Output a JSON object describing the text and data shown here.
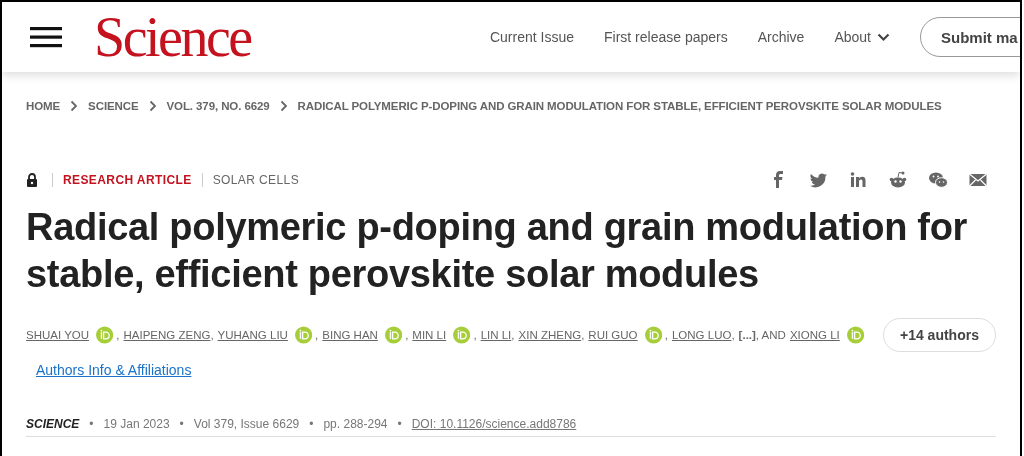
{
  "header": {
    "logo": "Science",
    "nav": [
      {
        "label": "Current Issue",
        "dropdown": false
      },
      {
        "label": "First release papers",
        "dropdown": false
      },
      {
        "label": "Archive",
        "dropdown": false
      },
      {
        "label": "About",
        "dropdown": true
      }
    ],
    "submit_button": "Submit ma"
  },
  "breadcrumb": [
    "HOME",
    "SCIENCE",
    "VOL. 379, NO. 6629",
    "RADICAL POLYMERIC P-DOPING AND GRAIN MODULATION FOR STABLE, EFFICIENT PEROVSKITE SOLAR MODULES"
  ],
  "article_type": "RESEARCH ARTICLE",
  "subject": "SOLAR CELLS",
  "title": "Radical polymeric p-doping and grain modulation for stable, efficient perovskite solar modules",
  "authors": [
    {
      "kind": "author",
      "text": "SHUAI YOU",
      "orcid": true
    },
    {
      "kind": "plain",
      "text": ","
    },
    {
      "kind": "author",
      "text": "HAIPENG ZENG",
      "orcid": false
    },
    {
      "kind": "plain",
      "text": ","
    },
    {
      "kind": "author",
      "text": "YUHANG LIU",
      "orcid": true
    },
    {
      "kind": "plain",
      "text": ","
    },
    {
      "kind": "author",
      "text": "BING HAN",
      "orcid": true
    },
    {
      "kind": "plain",
      "text": ","
    },
    {
      "kind": "author",
      "text": "MIN LI",
      "orcid": true
    },
    {
      "kind": "plain",
      "text": ","
    },
    {
      "kind": "author",
      "text": "LIN LI",
      "orcid": false
    },
    {
      "kind": "plain",
      "text": ","
    },
    {
      "kind": "author",
      "text": "XIN ZHENG",
      "orcid": false
    },
    {
      "kind": "plain",
      "text": ","
    },
    {
      "kind": "author",
      "text": "RUI GUO",
      "orcid": true
    },
    {
      "kind": "plain",
      "text": ","
    },
    {
      "kind": "author",
      "text": "LONG LUO",
      "orcid": false
    },
    {
      "kind": "plain",
      "text": ","
    },
    {
      "kind": "bold",
      "text": "[...]"
    },
    {
      "kind": "plain",
      "text": ", AND"
    },
    {
      "kind": "author",
      "text": "XIONG LI",
      "orcid": true
    }
  ],
  "more_authors": "+14 authors",
  "affiliations_link": "Authors Info & Affiliations",
  "meta": {
    "separator": "•",
    "items": [
      {
        "kind": "journal",
        "text": "SCIENCE"
      },
      {
        "kind": "plain",
        "text": "19 Jan 2023"
      },
      {
        "kind": "plain",
        "text": "Vol 379, Issue 6629"
      },
      {
        "kind": "plain",
        "text": "pp. 288-294"
      },
      {
        "kind": "link",
        "text": "DOI: 10.1126/science.add8786"
      }
    ]
  }
}
